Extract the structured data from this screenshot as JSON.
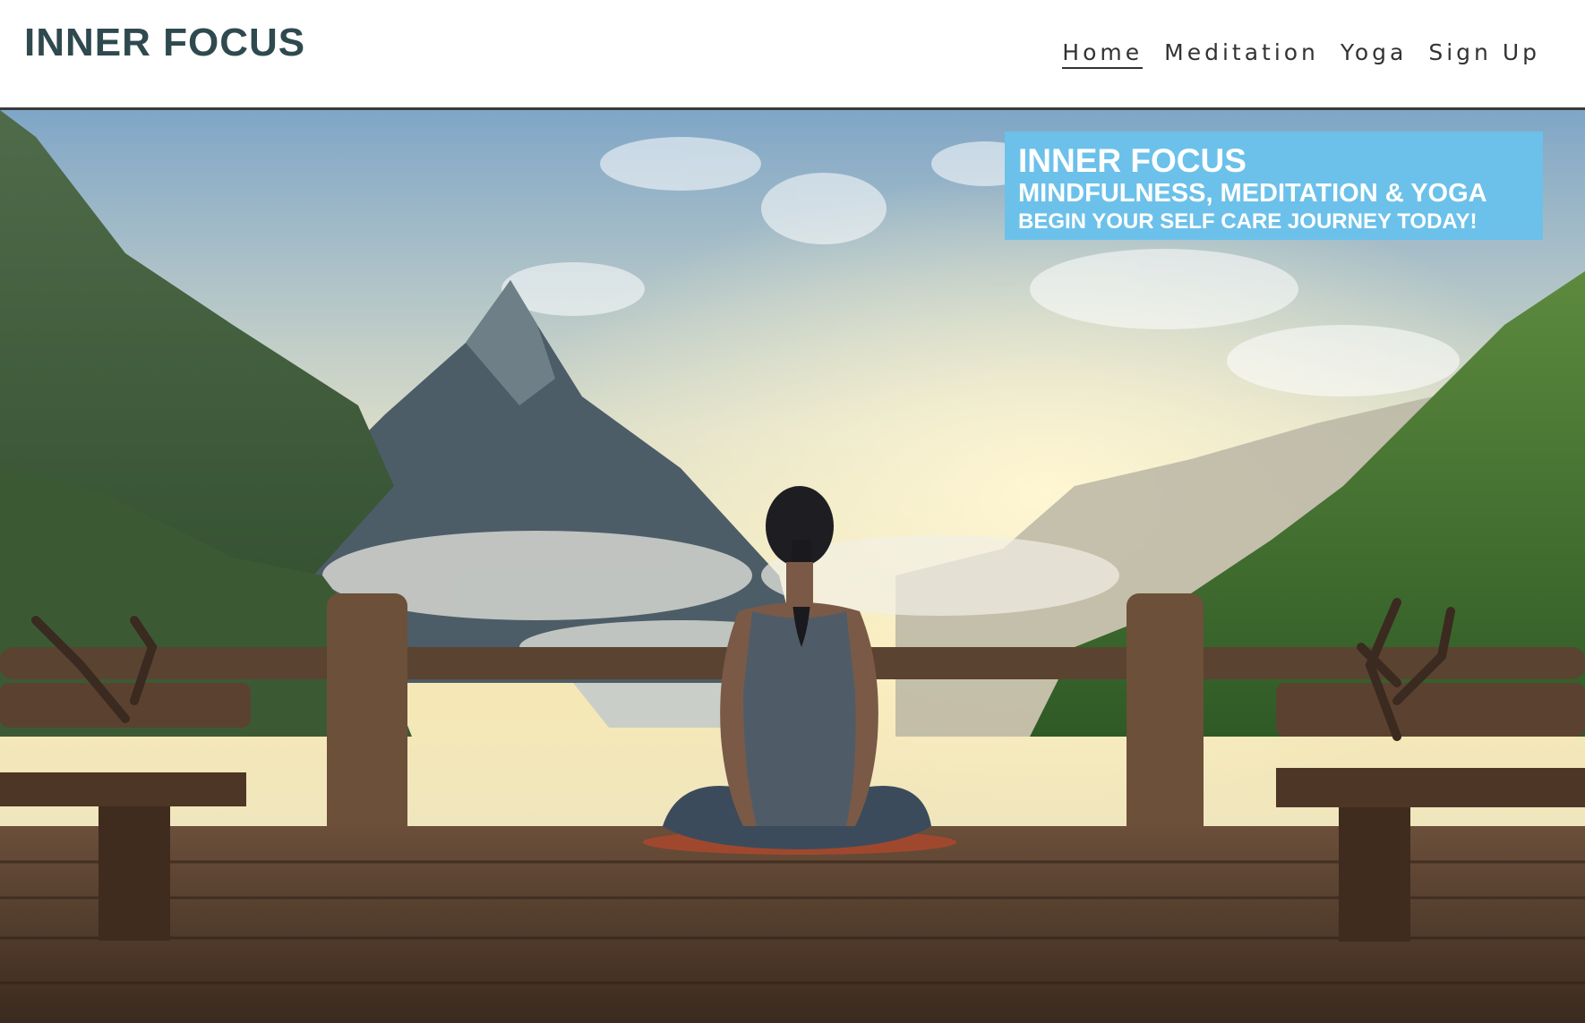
{
  "header": {
    "logo": "INNER FOCUS",
    "nav": [
      {
        "label": "Home",
        "active": true
      },
      {
        "label": "Meditation",
        "active": false
      },
      {
        "label": "Yoga",
        "active": false
      },
      {
        "label": "Sign Up",
        "active": false
      }
    ]
  },
  "hero": {
    "badge": {
      "title": "INNER FOCUS",
      "subtitle": "MINDFULNESS, MEDITATION & YOGA",
      "tagline": "BEGIN YOUR SELF CARE JOURNEY TODAY!"
    }
  },
  "colors": {
    "logo": "#2f4a4f",
    "badge": "#6cc1ea",
    "nav_text": "#333333"
  }
}
